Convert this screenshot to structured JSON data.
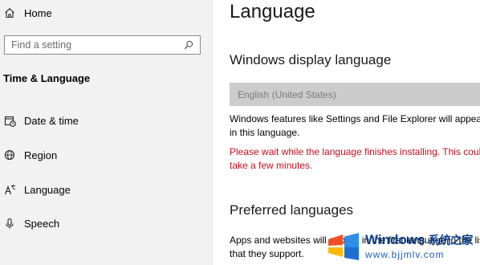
{
  "sidebar": {
    "home_label": "Home",
    "search_placeholder": "Find a setting",
    "section_title": "Time & Language",
    "items": [
      {
        "label": "Date & time",
        "icon": "calendar-clock-icon"
      },
      {
        "label": "Region",
        "icon": "globe-icon"
      },
      {
        "label": "Language",
        "icon": "language-icon"
      },
      {
        "label": "Speech",
        "icon": "microphone-icon"
      }
    ]
  },
  "main": {
    "title": "Language",
    "display_language_heading": "Windows display language",
    "display_language_value": "English (United States)",
    "features_text": "Windows features like Settings and File Explorer will appear in this language.",
    "warning_text": "Please wait while the language finishes installing. This could take a few minutes.",
    "preferred_heading": "Preferred languages",
    "apps_text": "Apps and websites will appear in the first language in the list that they support."
  },
  "watermark": {
    "brand": "Windows",
    "chinese": "系统之家",
    "url": "www.bjjmlv.com"
  },
  "colors": {
    "sidebar_bg": "#f2f2f2",
    "warning": "#c50f1f",
    "watermark_blue": "#0b3e8a"
  }
}
